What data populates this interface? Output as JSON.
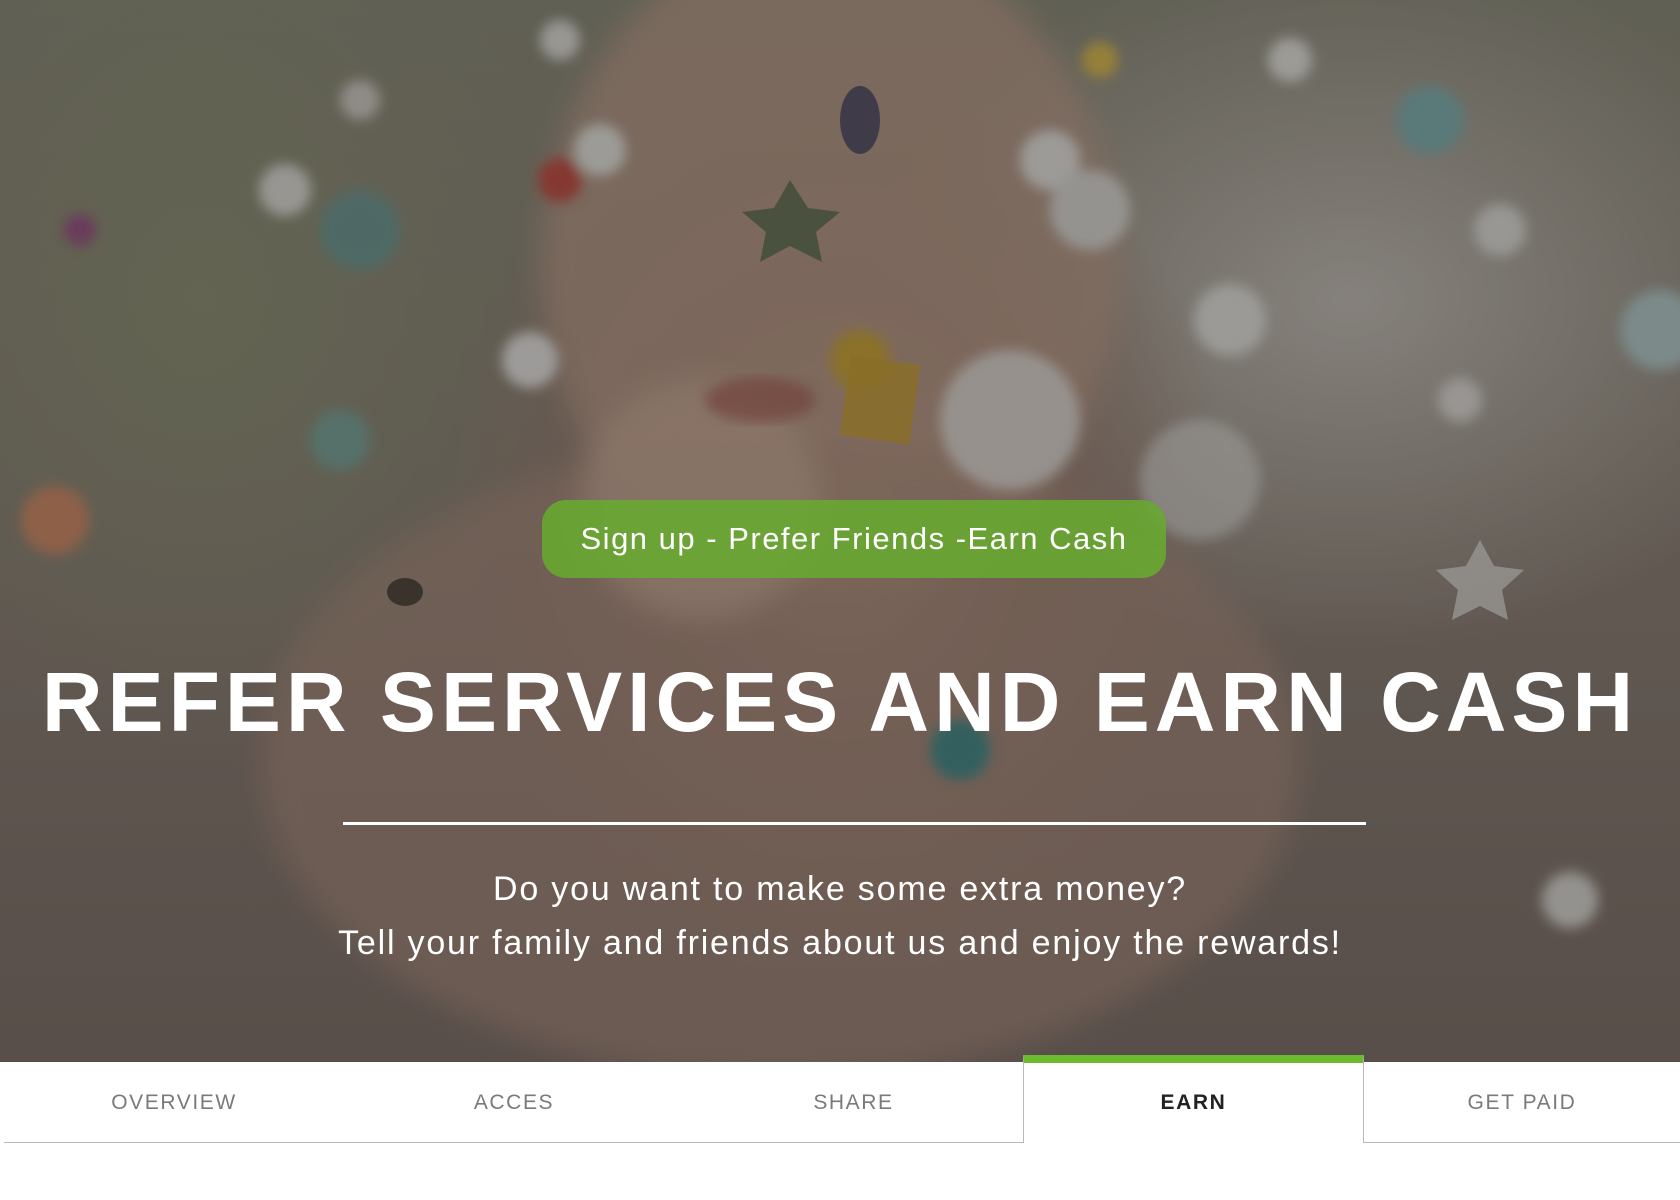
{
  "hero": {
    "cta_label": "Sign up - Prefer Friends -Earn Cash",
    "title": "REFER SERVICES AND EARN CASH",
    "subtitle_line1": "Do you want to make some extra money?",
    "subtitle_line2": "Tell your family and friends about us and enjoy the rewards!",
    "background_image": "confetti-blowing-photo"
  },
  "tabs": {
    "items": [
      {
        "label": "OVERVIEW",
        "active": false
      },
      {
        "label": "ACCES",
        "active": false
      },
      {
        "label": "SHARE",
        "active": false
      },
      {
        "label": "EARN",
        "active": true
      },
      {
        "label": "GET PAID",
        "active": false
      }
    ]
  },
  "colors": {
    "accent_green": "#6cbb2f",
    "cta_green": "#68aa30",
    "text_white": "#ffffff",
    "tab_inactive": "#7a7a7a",
    "tab_active": "#222222"
  }
}
